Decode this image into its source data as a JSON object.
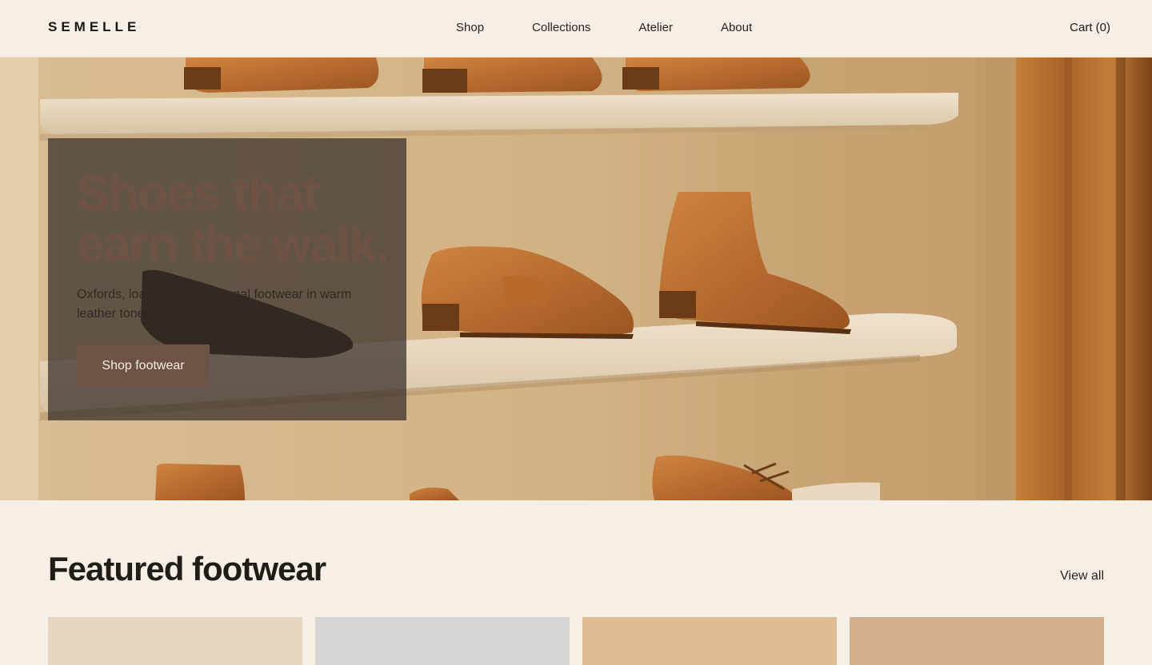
{
  "brand": {
    "name": "SEMELLE"
  },
  "nav": {
    "items": [
      {
        "label": "Shop"
      },
      {
        "label": "Collections"
      },
      {
        "label": "Atelier"
      },
      {
        "label": "About"
      }
    ],
    "cart_label": "Cart (0)"
  },
  "hero": {
    "title_line1": "Shoes that",
    "title_line2": "earn the walk.",
    "subtitle": "Oxfords, loafers, and seasonal footwear in warm leather tones.",
    "cta_label": "Shop footwear",
    "image_icon": "shoe-shelf-photo"
  },
  "featured": {
    "title": "Featured footwear",
    "view_all_label": "View all",
    "cards": [
      {
        "icon": "product-image",
        "color": "#e6d6c0"
      },
      {
        "icon": "product-image",
        "color": "#d6d5d3"
      },
      {
        "icon": "product-image",
        "color": "#dfbc91"
      },
      {
        "icon": "product-image",
        "color": "#d2ae8a"
      }
    ]
  },
  "colors": {
    "background": "#f6efe6",
    "accent": "#6e5246",
    "text": "#2a231f"
  }
}
